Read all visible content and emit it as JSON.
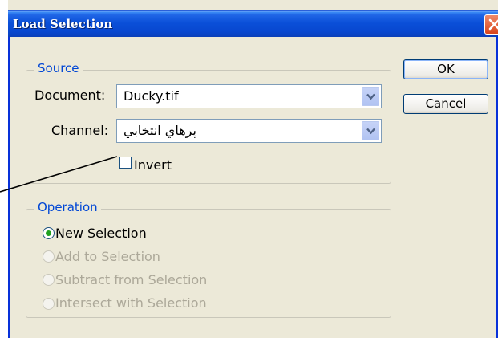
{
  "window": {
    "title": "Load Selection"
  },
  "source": {
    "legend": "Source",
    "document_label": "Document:",
    "document_value": "Ducky.tif",
    "channel_label": "Channel:",
    "channel_value": "پرهاي انتخابي",
    "invert_label": "Invert",
    "invert_checked": false
  },
  "operation": {
    "legend": "Operation",
    "options": [
      {
        "label": "New Selection",
        "selected": true,
        "enabled": true
      },
      {
        "label": "Add to Selection",
        "selected": false,
        "enabled": false
      },
      {
        "label": "Subtract from Selection",
        "selected": false,
        "enabled": false
      },
      {
        "label": "Intersect with Selection",
        "selected": false,
        "enabled": false
      }
    ]
  },
  "buttons": {
    "ok": "OK",
    "cancel": "Cancel"
  },
  "icons": {
    "close": "close-icon",
    "dropdown_arrow": "chevron-down-icon",
    "radio_selected": "radio-selected-icon"
  },
  "colors": {
    "titlebar": "#0a4fd8",
    "legend": "#0046d5",
    "dialog_bg": "#ece9d8",
    "close": "#d9451b"
  }
}
